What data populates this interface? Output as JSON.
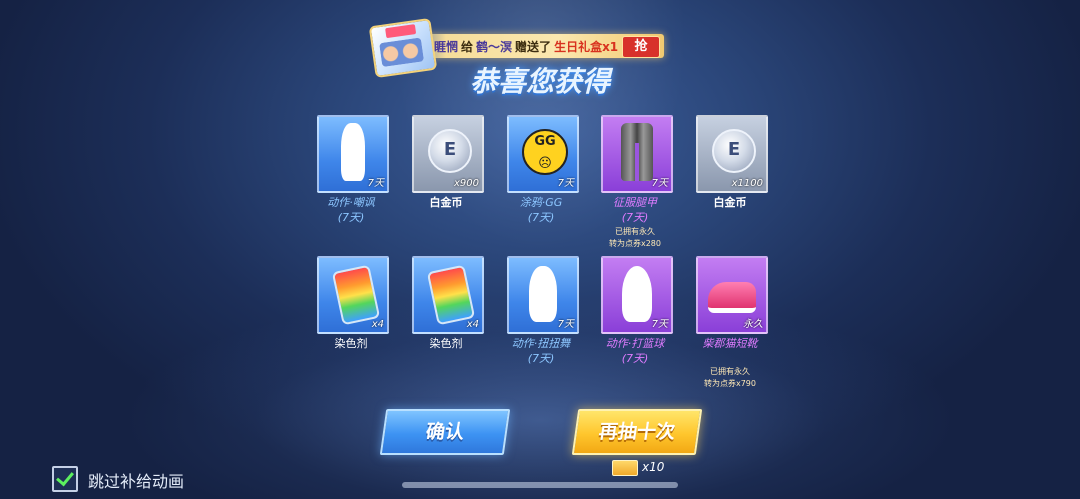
{
  "banner": {
    "user": "睚惘",
    "give": "给",
    "target": "鹤～溟",
    "action": "赠送了",
    "gift": "生日礼盒x1",
    "grab_label": "抢"
  },
  "title": "恭喜您获得",
  "items": [
    {
      "name": "动作·嘲讽",
      "sub": "(7天)",
      "qty": "7天",
      "color": "blue",
      "icon": "silhouette-icon",
      "note": ""
    },
    {
      "name": "白金币",
      "sub": "",
      "qty": "x900",
      "color": "gray",
      "icon": "platinum-coin-icon",
      "note": ""
    },
    {
      "name": "涂鸦·GG",
      "sub": "(7天)",
      "qty": "7天",
      "color": "blue",
      "icon": "gg-graffiti-icon",
      "note": ""
    },
    {
      "name": "征服腿甲",
      "sub": "(7天)",
      "qty": "7天",
      "color": "purple",
      "icon": "leg-armor-icon",
      "note1": "已拥有永久",
      "note2": "转为点券x280"
    },
    {
      "name": "白金币",
      "sub": "",
      "qty": "x1100",
      "color": "gray",
      "icon": "platinum-coin-icon",
      "note": ""
    },
    {
      "name": "染色剂",
      "sub": "",
      "qty": "x4",
      "color": "blue",
      "icon": "dye-can-icon",
      "note": ""
    },
    {
      "name": "染色剂",
      "sub": "",
      "qty": "x4",
      "color": "blue",
      "icon": "dye-can-icon",
      "note": ""
    },
    {
      "name": "动作·扭扭舞",
      "sub": "(7天)",
      "qty": "7天",
      "color": "blue",
      "icon": "silhouette-icon",
      "note": ""
    },
    {
      "name": "动作·打篮球",
      "sub": "(7天)",
      "qty": "7天",
      "color": "purple",
      "icon": "silhouette-icon",
      "note": ""
    },
    {
      "name": "柴郡猫短靴",
      "sub": "",
      "qty": "永久",
      "color": "purple",
      "icon": "sneaker-icon",
      "note1": "已拥有永久",
      "note2": "转为点券x790"
    }
  ],
  "buttons": {
    "confirm": "确认",
    "draw_ten": "再抽十次"
  },
  "ticket": {
    "count": "x10",
    "icon": "draw-ticket-icon"
  },
  "skip": {
    "label": "跳过补给动画",
    "checked": true
  }
}
